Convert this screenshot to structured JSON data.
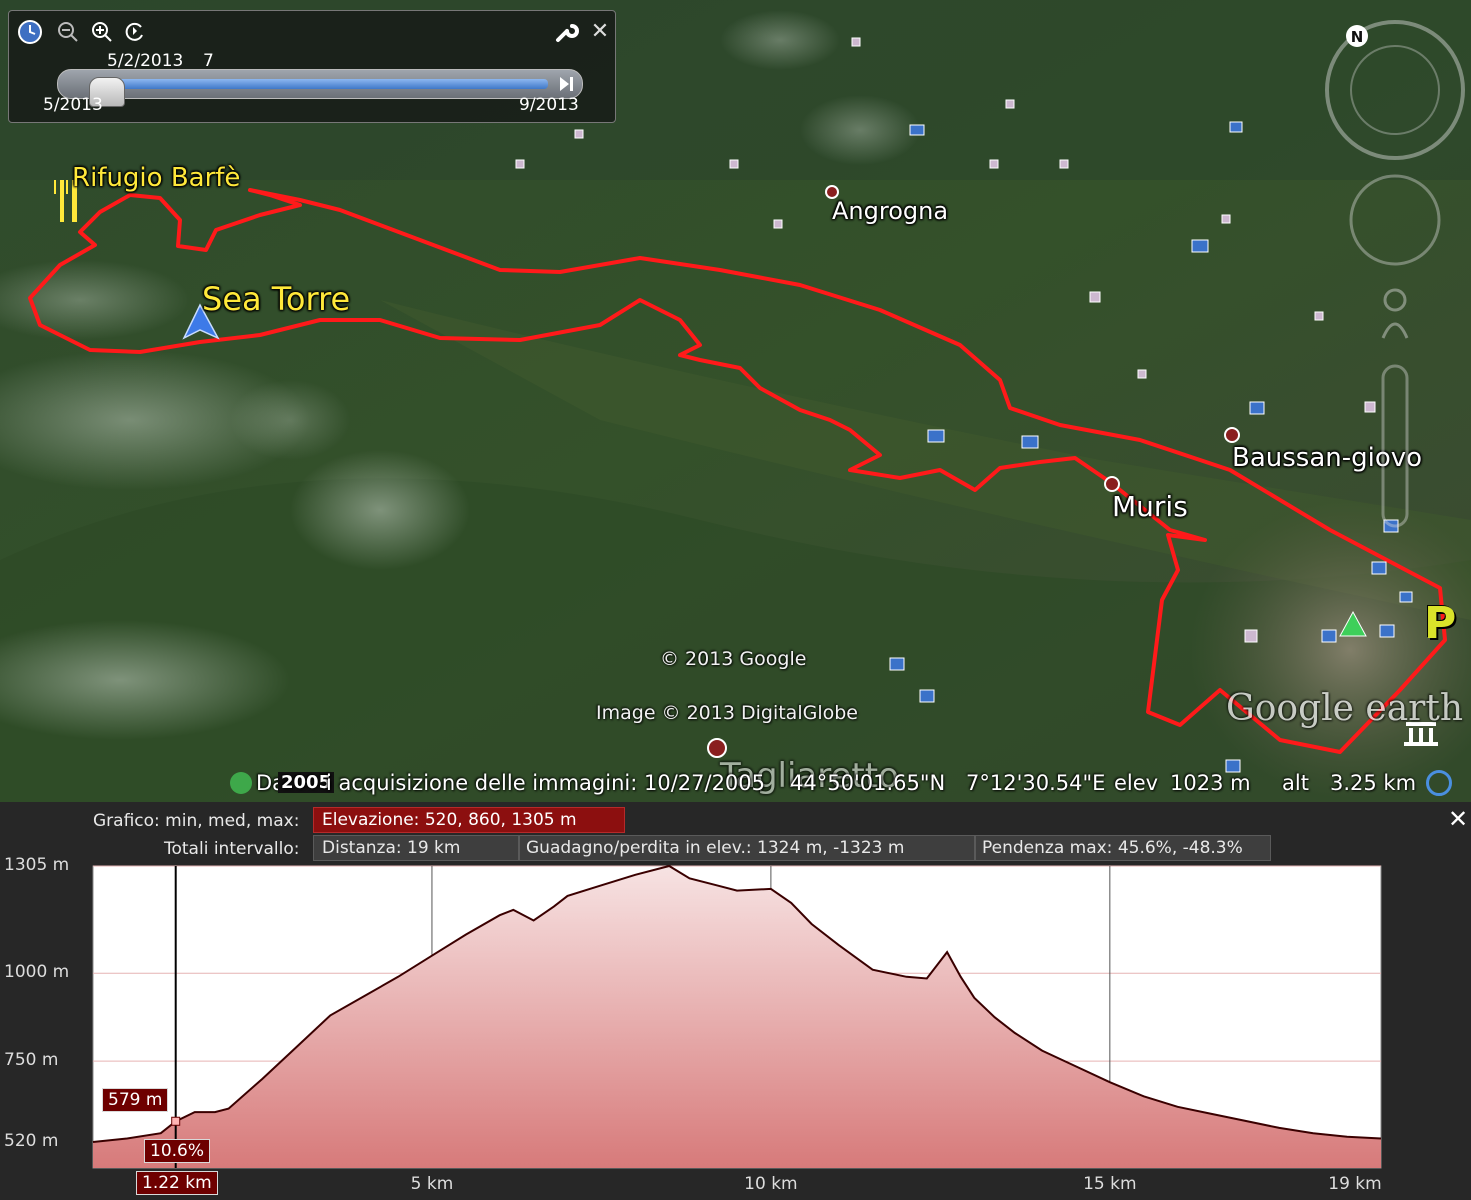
{
  "time_slider": {
    "current_label": "5/2/2013",
    "current_suffix": "7",
    "start_label": "5/2013",
    "end_label": "9/2013",
    "position": 0.06
  },
  "map": {
    "places": {
      "rifugio": "Rifugio Barfè",
      "sea_torre": "Sea Torre",
      "angrogna": "Angrogna",
      "baussan": "Baussan-giovo",
      "muris": "Muris",
      "tagliaretto": "Tagliaretto"
    },
    "copyright": "© 2013 Google",
    "imagery": "Image © 2013 DigitalGlobe",
    "logo": "Google earth",
    "parking_letter": "P"
  },
  "status": {
    "date_prefix": "Da",
    "year_badge": "2005",
    "date_text": "i acquisizione delle immagini: 10/27/2005",
    "lat": "44°50'01.65\"N",
    "lon": "7°12'30.54\"E",
    "elev_label": "elev",
    "elev_value": "1023 m",
    "alt_label": "alt",
    "alt_value": "3.25 km"
  },
  "profile": {
    "row1_label": "Grafico: min, med, max:",
    "elevation": "Elevazione: 520, 860, 1305 m",
    "row2_label": "Totali intervallo:",
    "distance": "Distanza: 19 km",
    "gain": "Guadagno/perdita in elev.: 1324 m, -1323 m",
    "slope": "Pendenza max: 45.6%, -48.3%",
    "cursor": {
      "distance_label": "1.22 km",
      "elevation_label": "579 m",
      "slope_label": "10.6%",
      "x_km": 1.22
    }
  },
  "chart_data": {
    "type": "area",
    "xlabel": "",
    "ylabel": "",
    "xlim": [
      0,
      19
    ],
    "ylim": [
      520,
      1305
    ],
    "y_ticks": [
      {
        "value": 1305,
        "label": "1305 m"
      },
      {
        "value": 1000,
        "label": "1000 m"
      },
      {
        "value": 750,
        "label": "750 m"
      },
      {
        "value": 520,
        "label": "520 m"
      }
    ],
    "x_ticks": [
      {
        "value": 5,
        "label": "5 km"
      },
      {
        "value": 10,
        "label": "10 km"
      },
      {
        "value": 15,
        "label": "15 km"
      },
      {
        "value": 19,
        "label": "19 km"
      }
    ],
    "grid": true,
    "series": [
      {
        "x": [
          0,
          0.5,
          1.0,
          1.22,
          1.5,
          1.8,
          2.0,
          2.5,
          3.0,
          3.5,
          4.0,
          4.5,
          5.0,
          5.5,
          6.0,
          6.2,
          6.5,
          6.8,
          7.0,
          7.5,
          8.0,
          8.5,
          8.8,
          9.2,
          9.5,
          10.0,
          10.3,
          10.6,
          11.0,
          11.5,
          12.0,
          12.3,
          12.6,
          12.8,
          13.0,
          13.3,
          13.6,
          14.0,
          14.5,
          15.0,
          15.5,
          16.0,
          16.5,
          17.0,
          17.5,
          18.0,
          18.5,
          19.0
        ],
        "y": [
          520,
          530,
          545,
          579,
          605,
          605,
          615,
          700,
          790,
          880,
          935,
          990,
          1050,
          1110,
          1165,
          1180,
          1150,
          1190,
          1220,
          1250,
          1280,
          1305,
          1270,
          1250,
          1235,
          1240,
          1200,
          1140,
          1080,
          1010,
          990,
          985,
          1060,
          990,
          930,
          875,
          830,
          780,
          735,
          690,
          650,
          620,
          600,
          580,
          560,
          545,
          535,
          530
        ]
      }
    ]
  }
}
